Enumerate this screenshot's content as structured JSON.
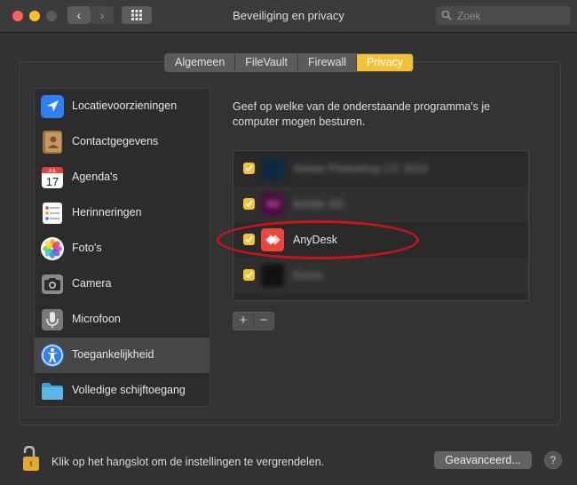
{
  "window": {
    "title": "Beveiliging en privacy"
  },
  "search": {
    "placeholder": "Zoek"
  },
  "tabs": [
    {
      "label": "Algemeen"
    },
    {
      "label": "FileVault"
    },
    {
      "label": "Firewall"
    },
    {
      "label": "Privacy",
      "active": true
    }
  ],
  "sidebar": {
    "items": [
      {
        "label": "Locatievoorzieningen",
        "icon": "location-arrow-icon"
      },
      {
        "label": "Contactgegevens",
        "icon": "contacts-book-icon"
      },
      {
        "label": "Agenda's",
        "icon": "calendar-icon",
        "calendar_month": "JUL",
        "calendar_day": "17"
      },
      {
        "label": "Herinneringen",
        "icon": "reminders-list-icon"
      },
      {
        "label": "Foto's",
        "icon": "photos-flower-icon"
      },
      {
        "label": "Camera",
        "icon": "camera-icon"
      },
      {
        "label": "Microfoon",
        "icon": "microphone-icon"
      },
      {
        "label": "Toegankelijkheid",
        "icon": "accessibility-icon",
        "selected": true
      },
      {
        "label": "Volledige schijftoegang",
        "icon": "folder-icon"
      }
    ]
  },
  "content": {
    "description": "Geef op welke van de onderstaande programma's je computer mogen besturen.",
    "apps": [
      {
        "name": "Adobe Photoshop CC 2019",
        "checked": true,
        "icon": "photoshop-icon",
        "blurred": true
      },
      {
        "name": "Adobe XD",
        "checked": true,
        "icon": "adobe-xd-icon",
        "icon_text": "Xd",
        "blurred": true
      },
      {
        "name": "AnyDesk",
        "checked": true,
        "icon": "anydesk-icon",
        "blurred": false
      },
      {
        "name": "Dores",
        "checked": true,
        "icon": "app-icon",
        "blurred": true
      }
    ],
    "add_label": "+",
    "remove_label": "−"
  },
  "footer": {
    "lock_text": "Klik op het hangslot om de instellingen te vergrendelen.",
    "advanced_label": "Geavanceerd...",
    "help_label": "?"
  },
  "colors": {
    "accent": "#f5c137",
    "highlight_ellipse": "#c8141c",
    "anydesk_red": "#ef443b"
  }
}
